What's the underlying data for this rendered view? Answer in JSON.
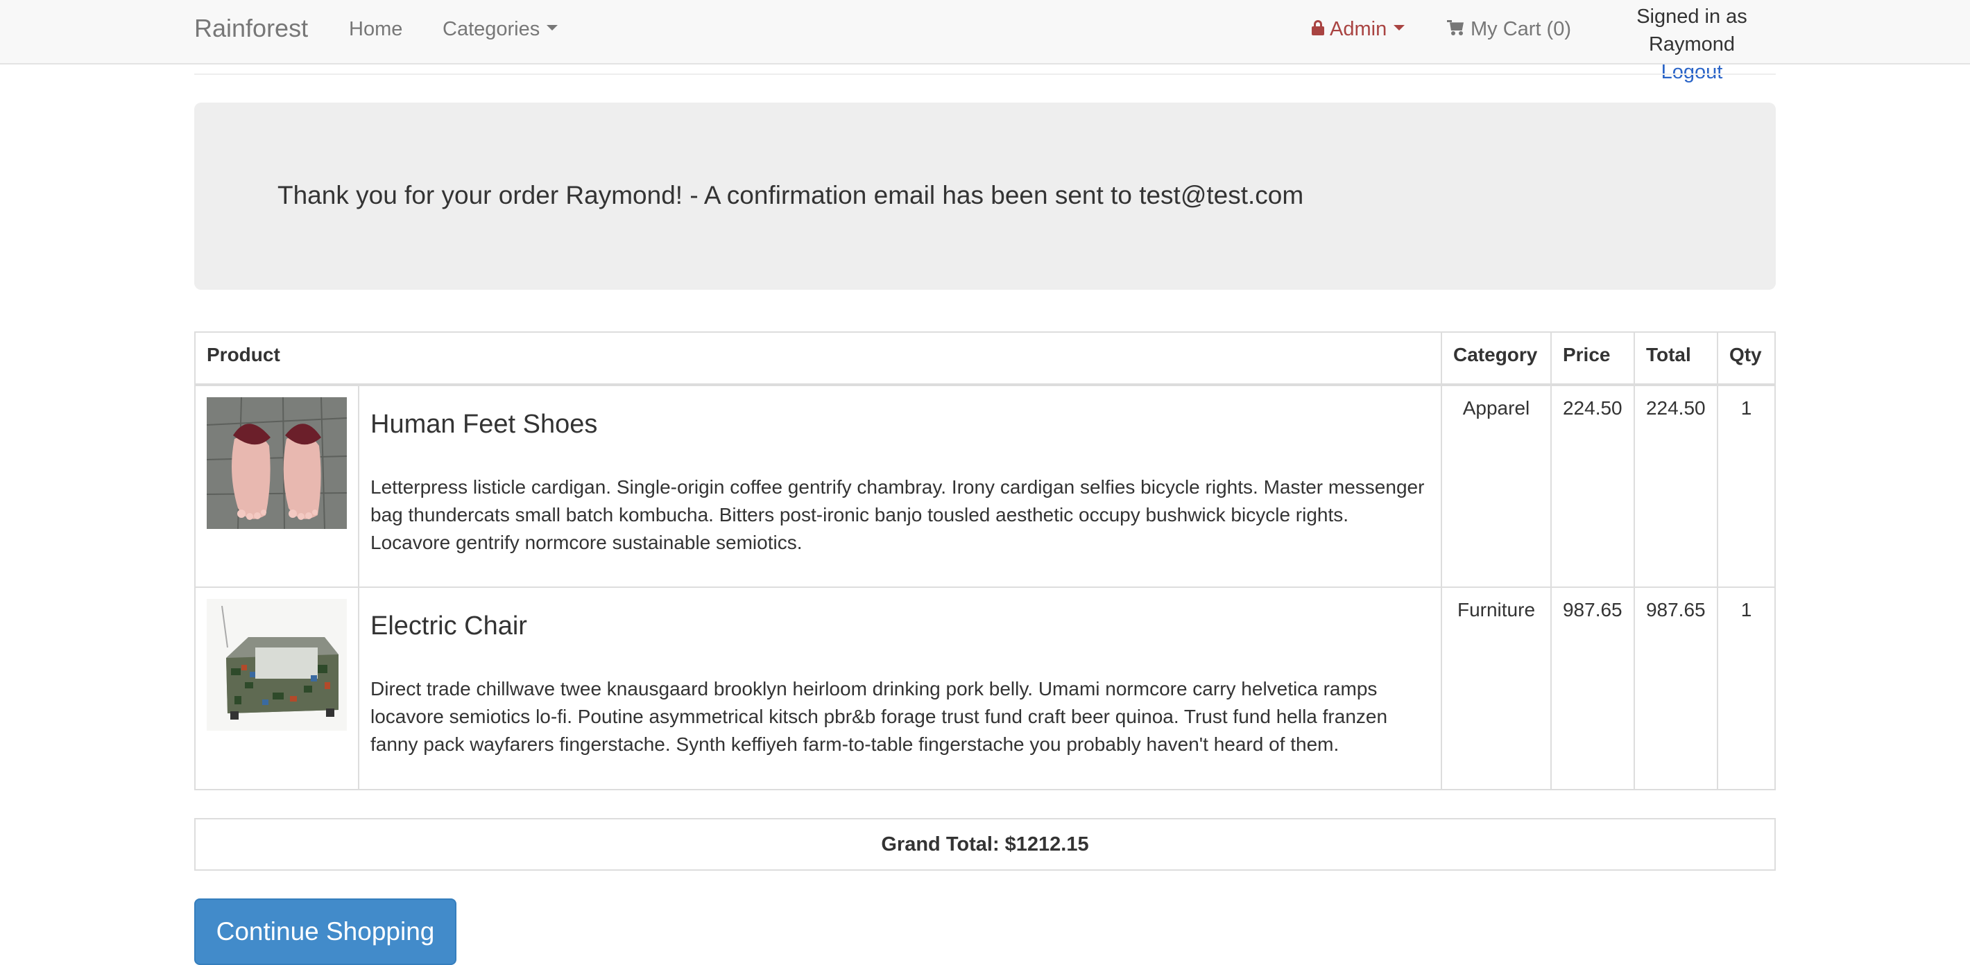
{
  "navbar": {
    "brand": "Rainforest",
    "home": "Home",
    "categories": "Categories",
    "admin": "Admin",
    "cart": "My Cart (0)",
    "signed_in": "Signed in as Raymond",
    "logout": "Logout"
  },
  "confirmation": {
    "message": "Thank you for your order Raymond! - A confirmation email has been sent to test@test.com"
  },
  "table": {
    "headers": {
      "product": "Product",
      "category": "Category",
      "price": "Price",
      "total": "Total",
      "qty": "Qty"
    },
    "rows": [
      {
        "name": "Human Feet Shoes",
        "description": "Letterpress listicle cardigan. Single-origin coffee gentrify chambray. Irony cardigan selfies bicycle rights. Master messenger bag thundercats small batch kombucha. Bitters post-ironic banjo tousled aesthetic occupy bushwick bicycle rights. Locavore gentrify normcore sustainable semiotics.",
        "category": "Apparel",
        "price": "224.50",
        "total": "224.50",
        "qty": "1"
      },
      {
        "name": "Electric Chair",
        "description": "Direct trade chillwave twee knausgaard brooklyn heirloom drinking pork belly. Umami normcore carry helvetica ramps locavore semiotics lo-fi. Poutine asymmetrical kitsch pbr&b forage trust fund craft beer quinoa. Trust fund hella franzen fanny pack wayfarers fingerstache. Synth keffiyeh farm-to-table fingerstache you probably haven't heard of them.",
        "category": "Furniture",
        "price": "987.65",
        "total": "987.65",
        "qty": "1"
      }
    ]
  },
  "grand_total": "Grand Total: $1212.15",
  "continue_button": "Continue Shopping",
  "colors": {
    "navbar_bg": "#f8f8f8",
    "admin": "#a94442",
    "link": "#2a64c7",
    "button": "#428bca",
    "jumbotron_bg": "#eeeeee"
  }
}
